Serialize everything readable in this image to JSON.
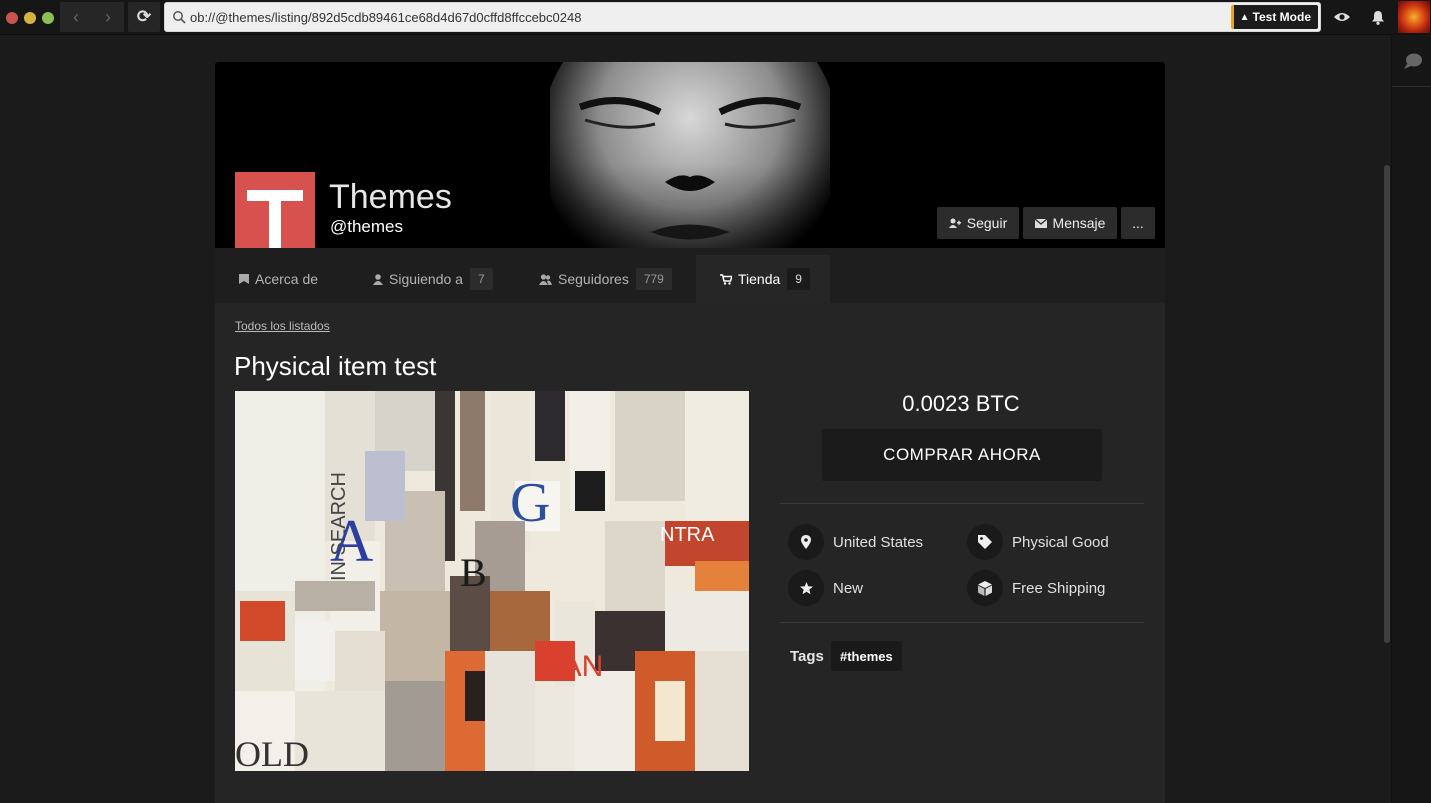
{
  "browser": {
    "url": "ob://@themes/listing/892d5cdb89461ce68d4d67d0cffd8ffccebc0248",
    "test_mode_label": "Test Mode"
  },
  "store": {
    "name": "Themes",
    "handle": "@themes",
    "follow_label": "Seguir",
    "message_label": "Mensaje",
    "more_label": "..."
  },
  "tabs": {
    "about": {
      "label": "Acerca de"
    },
    "following": {
      "label": "Siguiendo a",
      "count": "7"
    },
    "followers": {
      "label": "Seguidores",
      "count": "779"
    },
    "store": {
      "label": "Tienda",
      "count": "9"
    }
  },
  "listing": {
    "all_listings_link": "Todos los listados",
    "title": "Physical item test",
    "price": "0.0023 BTC",
    "buy_label": "COMPRAR AHORA",
    "features": {
      "location": "United States",
      "type": "Physical Good",
      "condition": "New",
      "shipping": "Free Shipping"
    },
    "tags_label": "Tags",
    "tags": [
      "#themes"
    ]
  },
  "colors": {
    "accent_test_mode": "#f0a020",
    "store_avatar": "#d7524f",
    "background": "#1b1b1b",
    "card": "#252525"
  }
}
